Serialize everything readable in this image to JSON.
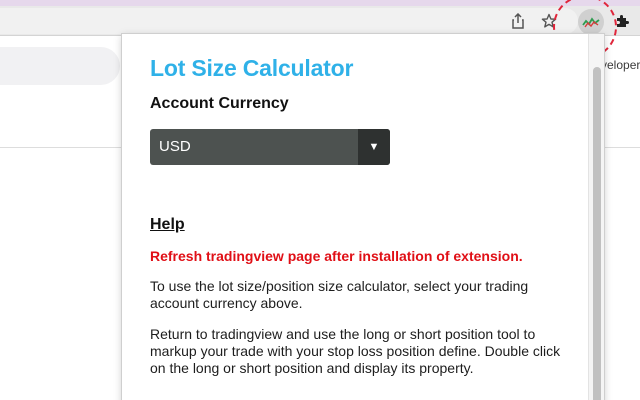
{
  "browser": {
    "toolbar_icons": [
      "share-icon",
      "star-icon",
      "extension-icon",
      "puzzle-icon"
    ],
    "highlight_color": "#e0263b"
  },
  "page": {
    "partial_link": "veloper"
  },
  "popup": {
    "title": "Lot Size Calculator",
    "title_color": "#2fb1e8",
    "account_currency_label": "Account Currency",
    "currency_select": {
      "selected": "USD",
      "arrow": "▼"
    },
    "help": {
      "heading": "Help",
      "warning": "Refresh tradingview page after installation of extension.",
      "warning_color": "#e00f16",
      "paragraph_1": "To use the lot size/position size calculator, select your trading account currency above.",
      "paragraph_2": "Return to tradingview and use the long or short position tool to markup your trade with your stop loss position define. Double click on the long or short position and display its property."
    }
  }
}
